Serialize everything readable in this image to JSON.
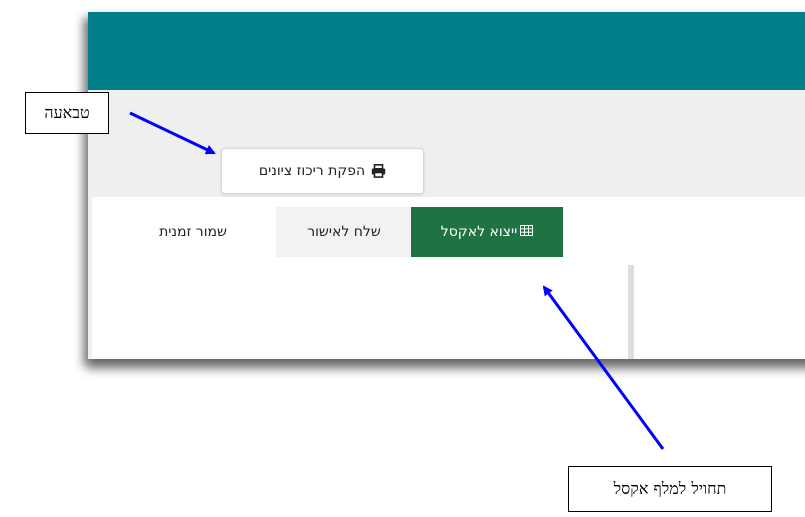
{
  "print_button": {
    "label": "הפקת ריכוז ציונים",
    "icon": "printer-icon"
  },
  "toolbar": {
    "export_excel_label": "ייצוא לאקסל",
    "export_excel_icon": "table-grid-icon",
    "send_approval_label": "שלח לאישור",
    "save_draft_label": "שמור זמנית"
  },
  "annotations": {
    "print_label": "טבאעה",
    "excel_label": "תחויל למלף אקסל"
  },
  "colors": {
    "header_bar": "#017f88",
    "export_button": "#1f7343",
    "arrow": "#0000ff"
  }
}
